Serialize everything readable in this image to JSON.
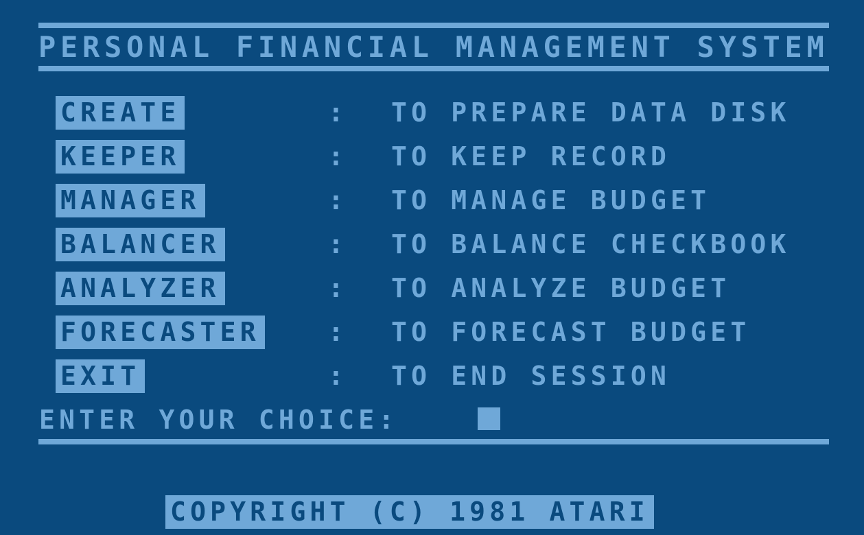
{
  "screen": {
    "background_color": "#0a4a7e",
    "foreground_color": "#6fa8d8"
  },
  "header": {
    "title": "PERSONAL FINANCIAL MANAGEMENT SYSTEM"
  },
  "menu": {
    "separator": ":",
    "items": [
      {
        "key": "CREATE",
        "separator": ":",
        "description": "TO PREPARE DATA DISK"
      },
      {
        "key": "KEEPER",
        "separator": ":",
        "description": "TO KEEP RECORD"
      },
      {
        "key": "MANAGER",
        "separator": ":",
        "description": "TO MANAGE BUDGET"
      },
      {
        "key": "BALANCER",
        "separator": ":",
        "description": "TO BALANCE CHECKBOOK"
      },
      {
        "key": "ANALYZER",
        "separator": ":",
        "description": "TO ANALYZE BUDGET"
      },
      {
        "key": "FORECASTER",
        "separator": ":",
        "description": "TO FORECAST BUDGET"
      },
      {
        "key": "EXIT",
        "separator": ":",
        "description": "TO END SESSION"
      }
    ]
  },
  "prompt": {
    "label": "ENTER YOUR CHOICE:",
    "value": "",
    "cursor_visible": true
  },
  "footer": {
    "copyright": "COPYRIGHT (C) 1981 ATARI"
  }
}
